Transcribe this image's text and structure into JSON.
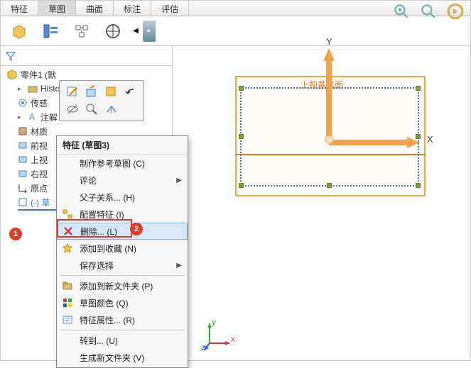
{
  "tabs": [
    "特征",
    "草图",
    "曲面",
    "标注",
    "评估"
  ],
  "activeTab": 1,
  "tree": {
    "root": "零件1 (默",
    "items": [
      "Histo",
      "传感",
      "注解",
      "材质",
      "前视",
      "上视",
      "右视",
      "原点",
      "(-) 草"
    ]
  },
  "contextMenu": {
    "header": "特征 (草图3)",
    "refSketch": "制作参考草图 (C)",
    "comment": "评论",
    "parent": "父子关系... (H)",
    "config": "配置特征 (I)",
    "delete": "删除... (L)",
    "addFav": "添加到收藏 (N)",
    "saveSel": "保存选择",
    "addFolder": "添加到新文件夹 (P)",
    "color": "草图颜色 (Q)",
    "props": "特征属性... (R)",
    "goto": "转到... (U)",
    "newFolder": "生成新文件夹 (V)"
  },
  "plane": {
    "label": "上视基准面"
  },
  "axes": {
    "x": "X",
    "y": "Y",
    "triad": {
      "x": "x",
      "y": "y",
      "z": "z"
    }
  },
  "badges": {
    "one": "1",
    "two": "2"
  }
}
